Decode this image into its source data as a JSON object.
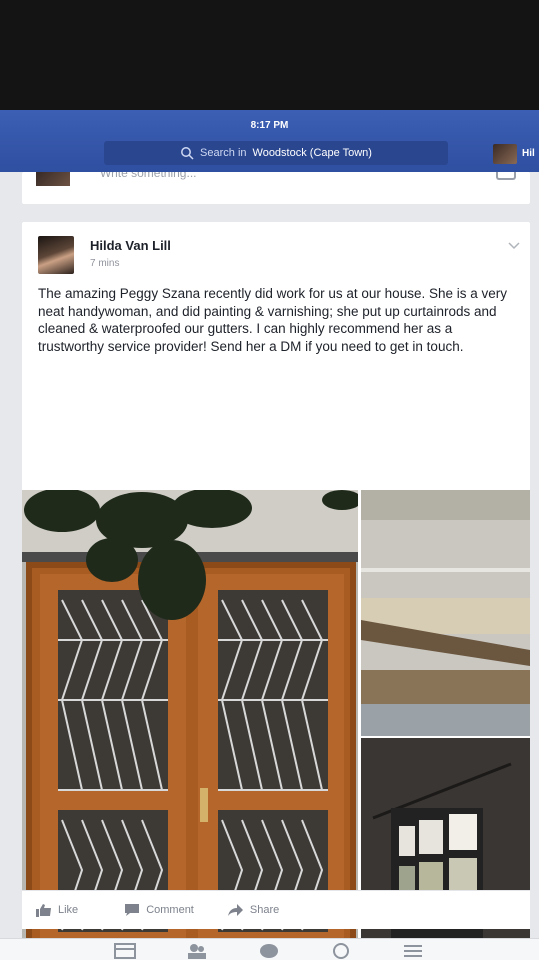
{
  "status": {
    "time": "8:17 PM"
  },
  "header": {
    "search_prefix": "Search in",
    "search_location": "Woodstock (Cape Town)",
    "profile_name": "Hil"
  },
  "composer": {
    "placeholder": "Write something..."
  },
  "post": {
    "author": "Hilda Van Lill",
    "time": "7 mins",
    "text": "The amazing Peggy Szana recently did work for us at our house. She is a very neat handywoman, and did painting & varnishing; she put up curtainrods and cleaned & waterproofed our gutters. I can highly recommend her as a trustworthy service provider! Send her a DM if you need to get in touch."
  },
  "actions": {
    "like": "Like",
    "comment": "Comment",
    "share": "Share"
  },
  "icons": {
    "search": "search-icon",
    "menu": "chevron-down-icon",
    "nav": [
      "feed-icon",
      "friends-icon",
      "messenger-icon",
      "globe-icon",
      "menu-icon"
    ]
  },
  "colors": {
    "brand": "#3b5998",
    "text": "#1d2129",
    "muted": "#90949c"
  }
}
